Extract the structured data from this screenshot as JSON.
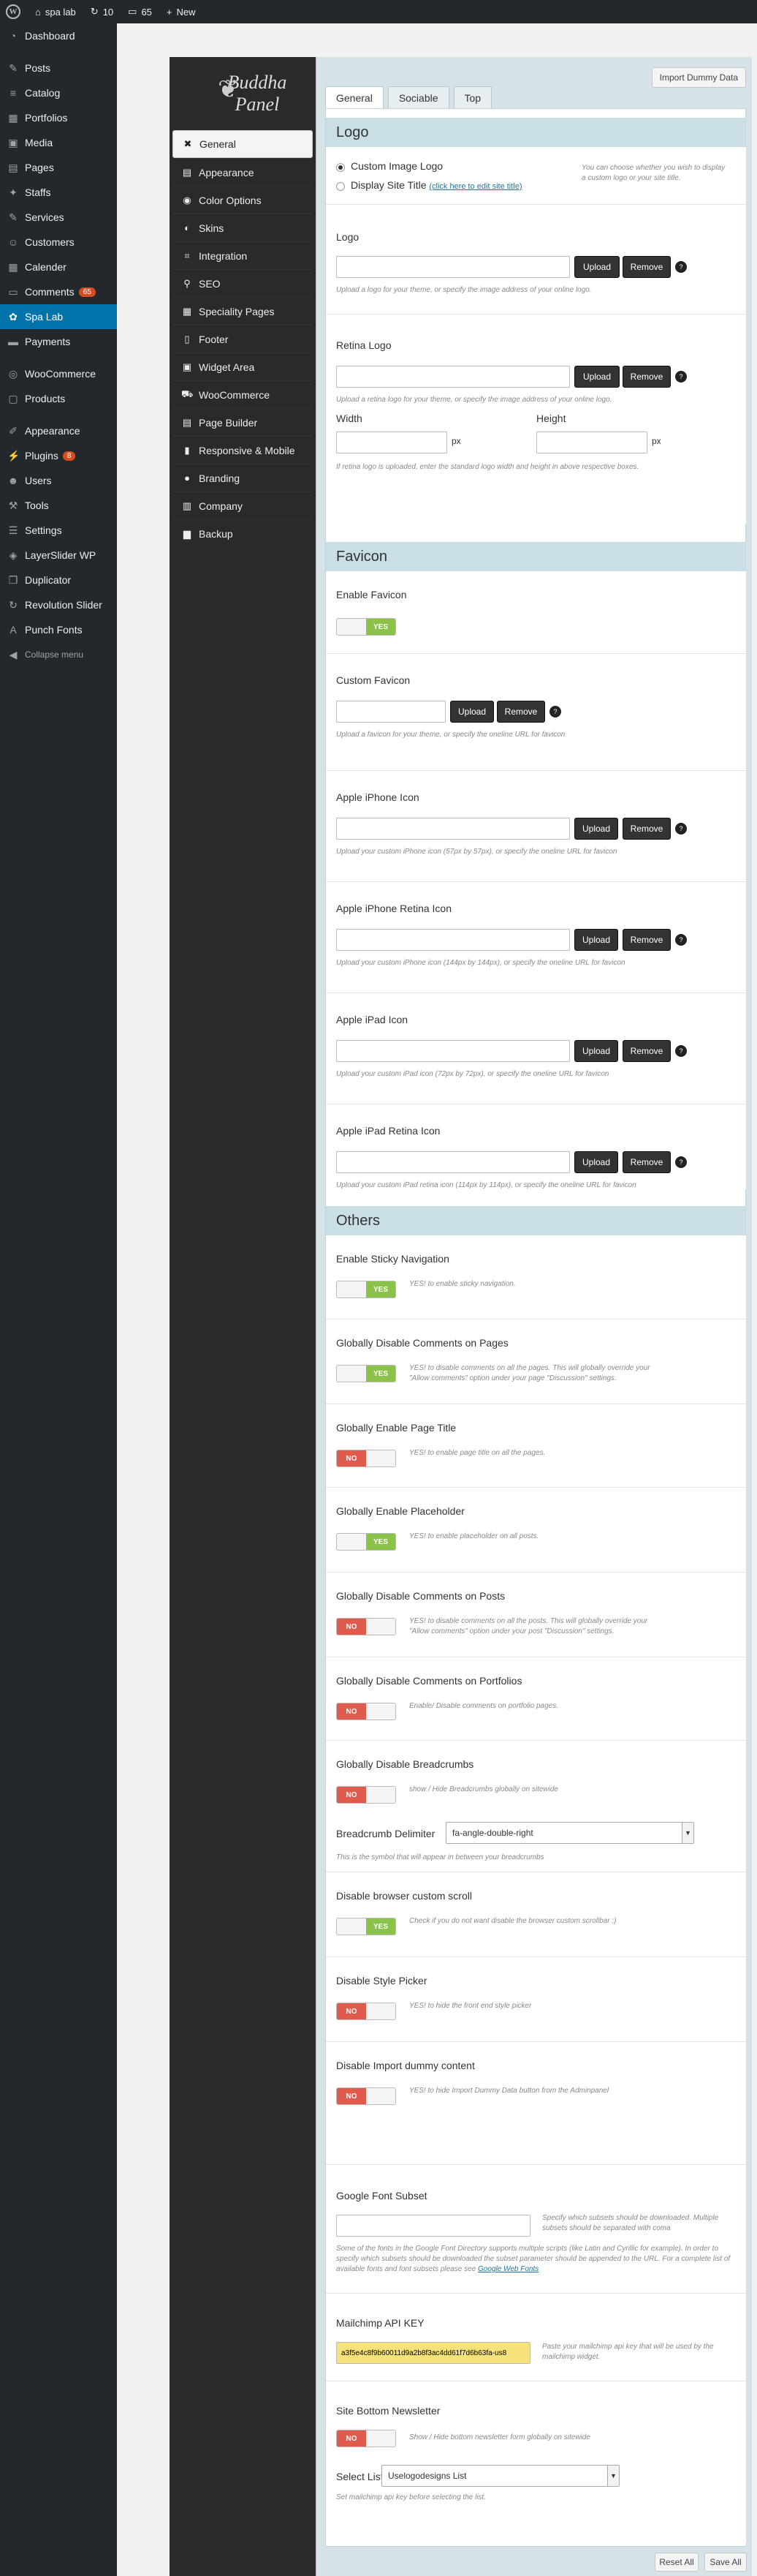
{
  "adminbar": {
    "site_name": "spa lab",
    "updates_count": "10",
    "comments_count": "65",
    "new_label": "New"
  },
  "adminmenu": {
    "items": [
      {
        "label": "Dashboard",
        "icon": "dashboard-icon"
      },
      {
        "label": "Posts",
        "icon": "pin-icon"
      },
      {
        "label": "Catalog",
        "icon": "list-icon"
      },
      {
        "label": "Portfolios",
        "icon": "grid-icon"
      },
      {
        "label": "Media",
        "icon": "media-icon"
      },
      {
        "label": "Pages",
        "icon": "page-icon"
      },
      {
        "label": "Staffs",
        "icon": "wrench-icon"
      },
      {
        "label": "Services",
        "icon": "pin-icon"
      },
      {
        "label": "Customers",
        "icon": "users-icon"
      },
      {
        "label": "Calender",
        "icon": "calendar-icon"
      },
      {
        "label": "Comments",
        "icon": "comment-icon",
        "badge": "65"
      },
      {
        "label": "Spa Lab",
        "icon": "gear-icon",
        "active": true
      },
      {
        "label": "Payments",
        "icon": "card-icon"
      },
      {
        "label": "WooCommerce",
        "icon": "cart-icon"
      },
      {
        "label": "Products",
        "icon": "box-icon"
      },
      {
        "label": "Appearance",
        "icon": "brush-icon"
      },
      {
        "label": "Plugins",
        "icon": "plug-icon",
        "badge": "8"
      },
      {
        "label": "Users",
        "icon": "user-icon"
      },
      {
        "label": "Tools",
        "icon": "tools-icon"
      },
      {
        "label": "Settings",
        "icon": "settings-icon"
      },
      {
        "label": "LayerSlider WP",
        "icon": "layers-icon"
      },
      {
        "label": "Duplicator",
        "icon": "copy-icon"
      },
      {
        "label": "Revolution Slider",
        "icon": "refresh-icon"
      },
      {
        "label": "Punch Fonts",
        "icon": "font-icon"
      }
    ],
    "collapse_label": "Collapse menu"
  },
  "panel": {
    "brand_line1": "Buddha",
    "brand_line2": "Panel",
    "sidebar": [
      {
        "label": "General",
        "icon": "wrench-icon",
        "active": true
      },
      {
        "label": "Appearance",
        "icon": "brush-icon"
      },
      {
        "label": "Color Options",
        "icon": "eye-icon"
      },
      {
        "label": "Skins",
        "icon": "tint-icon"
      },
      {
        "label": "Integration",
        "icon": "code-icon"
      },
      {
        "label": "SEO",
        "icon": "search-icon"
      },
      {
        "label": "Speciality Pages",
        "icon": "table-icon"
      },
      {
        "label": "Footer",
        "icon": "file-icon"
      },
      {
        "label": "Widget Area",
        "icon": "widget-icon"
      },
      {
        "label": "WooCommerce",
        "icon": "cart-icon"
      },
      {
        "label": "Page Builder",
        "icon": "doc-icon"
      },
      {
        "label": "Responsive & Mobile",
        "icon": "mobile-icon"
      },
      {
        "label": "Branding",
        "icon": "bulb-icon"
      },
      {
        "label": "Company",
        "icon": "building-icon"
      },
      {
        "label": "Backup",
        "icon": "archive-icon"
      }
    ],
    "import_label": "Import Dummy Data",
    "tabs": [
      "General",
      "Sociable",
      "Top"
    ],
    "reset_label": "Reset All",
    "save_label": "Save All"
  },
  "logo": {
    "title": "Logo",
    "radio1": "Custom Image Logo",
    "radio2": "Display Site Title",
    "radio2_link": "(click here to edit site title)",
    "radio_desc": "You can choose whether you wish to display a custom logo or your site title.",
    "logo_label": "Logo",
    "logo_desc": "Upload a logo for your theme, or specify the image address of your online logo.",
    "retina_label": "Retina Logo",
    "retina_desc": "Upload a retina logo for your theme, or specify the image address of your online logo.",
    "width_label": "Width",
    "height_label": "Height",
    "px": "px",
    "wh_desc": "If retina logo is uploaded, enter the standard logo width and height in above respective boxes.",
    "upload": "Upload",
    "remove": "Remove"
  },
  "favicon": {
    "title": "Favicon",
    "enable_label": "Enable Favicon",
    "custom_label": "Custom Favicon",
    "custom_desc": "Upload a favicon for your theme, or specify the oneline URL for favicon",
    "iphone_label": "Apple iPhone Icon",
    "iphone_desc": "Upload your custom iPhone icon (57px by 57px), or specify the oneline URL for favicon",
    "iphone_retina_label": "Apple iPhone Retina Icon",
    "iphone_retina_desc": "Upload your custom iPhone icon (144px by 144px), or specify the oneline URL for favicon",
    "ipad_label": "Apple iPad Icon",
    "ipad_desc": "Upload your custom iPad icon (72px by 72px), or specify the oneline URL for favicon",
    "ipad_retina_label": "Apple iPad Retina Icon",
    "ipad_retina_desc": "Upload your custom iPad retina icon (114px by 114px), or specify the oneline URL for favicon"
  },
  "others": {
    "title": "Others",
    "yes": "YES",
    "no": "NO",
    "items": [
      {
        "label": "Enable Sticky Navigation",
        "state": "yes",
        "desc": "YES! to enable sticky navigation."
      },
      {
        "label": "Globally Disable Comments on Pages",
        "state": "yes",
        "desc": "YES! to disable comments on all the pages. This will globally override your \"Allow comments\" option under your page \"Discussion\" settings."
      },
      {
        "label": "Globally Enable Page Title",
        "state": "no",
        "desc": "YES! to enable page title on all the pages."
      },
      {
        "label": "Globally Enable Placeholder",
        "state": "yes",
        "desc": "YES! to enable placeholder on all posts."
      },
      {
        "label": "Globally Disable Comments on Posts",
        "state": "no",
        "desc": "YES! to disable comments on all the posts. This will globally override your \"Allow comments\" option under your post \"Discussion\" settings."
      },
      {
        "label": "Globally Disable Comments on Portfolios",
        "state": "no",
        "desc": "Enable/ Disable comments on portfolio pages."
      },
      {
        "label": "Globally Disable Breadcrumbs",
        "state": "no",
        "desc": "show / Hide Breadcrumbs globally on sitewide"
      },
      {
        "label": "Disable browser custom scroll",
        "state": "yes",
        "desc": "Check if you do not want disable the browser custom scrollbar :)"
      },
      {
        "label": "Disable Style Picker",
        "state": "no",
        "desc": "YES! to hide the front end style picker"
      },
      {
        "label": "Disable Import dummy content",
        "state": "no",
        "desc": "YES! to hide Import Dummy Data button from the Adminpanel"
      }
    ],
    "breadcrumb_delim_label": "Breadcrumb Delimiter",
    "breadcrumb_delim_value": "fa-angle-double-right",
    "breadcrumb_delim_desc": "This is the symbol that will appear in between your breadcrumbs",
    "gfont_label": "Google Font Subset",
    "gfont_desc": "Specify which subsets should be downloaded. Multiple subsets should be separated with coma",
    "gfont_long": "Some of the fonts in the Google Font Directory supports multiple scripts (like Latin and Cyrillic for example). In order to specify which subsets should be downloaded the subset parameter should be appended to the URL. For a complete list of available fonts and font subsets please see",
    "gfont_link": "Google Web Fonts",
    "mailchimp_label": "Mailchimp API KEY",
    "mailchimp_value": "a3f5e4c8f9b60011d9a2b8f3ac4dd61f7d6b63fa-us8",
    "mailchimp_desc": "Paste your mailchimp api key that will be used by the mailchimp widget.",
    "newsletter_label": "Site Bottom Newsletter",
    "newsletter_state": "no",
    "newsletter_desc": "Show / Hide bottom newsletter form globally on sitewide",
    "select_list_label": "Select List",
    "select_list_value": "Uselogodesigns List",
    "select_list_desc": "Set mailchimp api key before selecting the list."
  },
  "colors": {
    "accent": "#0073aa",
    "yes_color": "#8bc34a",
    "no_color": "#e05a4d",
    "section_header": "#c9dee5"
  }
}
